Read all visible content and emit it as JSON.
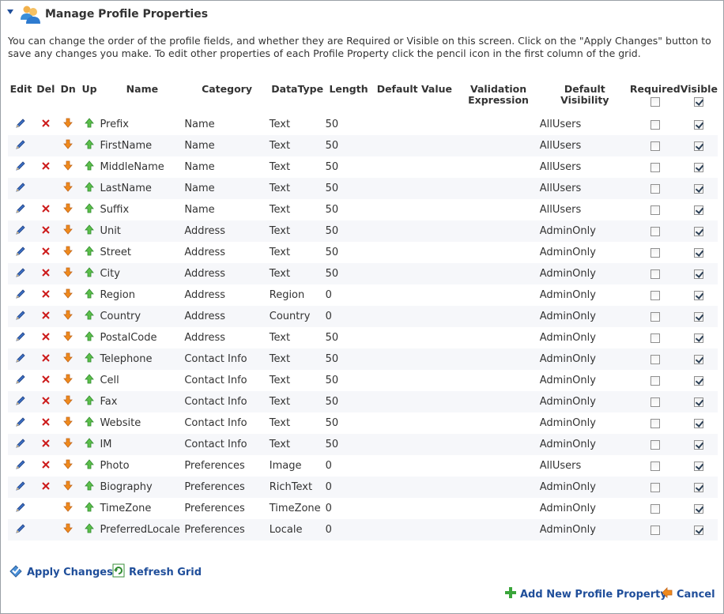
{
  "header": {
    "title": "Manage Profile Properties"
  },
  "intro": "You can change the order of the profile fields, and whether they are Required or Visible on this screen. Click on the \"Apply Changes\" button to save any changes you make. To edit other properties of each Profile Property click the pencil icon in the first column of the grid.",
  "columns": {
    "edit": "Edit",
    "del": "Del",
    "dn": "Dn",
    "up": "Up",
    "name": "Name",
    "category": "Category",
    "datatype": "DataType",
    "length": "Length",
    "default_value": "Default Value",
    "validation_1": "Validation",
    "validation_2": "Expression",
    "visibility_1": "Default",
    "visibility_2": "Visibility",
    "required": "Required",
    "visible": "Visible"
  },
  "rows": [
    {
      "name": "Prefix",
      "category": "Name",
      "datatype": "Text",
      "length": "50",
      "visibility": "AllUsers",
      "deletable": true,
      "required": false,
      "visible": true
    },
    {
      "name": "FirstName",
      "category": "Name",
      "datatype": "Text",
      "length": "50",
      "visibility": "AllUsers",
      "deletable": false,
      "required": false,
      "visible": true
    },
    {
      "name": "MiddleName",
      "category": "Name",
      "datatype": "Text",
      "length": "50",
      "visibility": "AllUsers",
      "deletable": true,
      "required": false,
      "visible": true
    },
    {
      "name": "LastName",
      "category": "Name",
      "datatype": "Text",
      "length": "50",
      "visibility": "AllUsers",
      "deletable": false,
      "required": false,
      "visible": true
    },
    {
      "name": "Suffix",
      "category": "Name",
      "datatype": "Text",
      "length": "50",
      "visibility": "AllUsers",
      "deletable": true,
      "required": false,
      "visible": true
    },
    {
      "name": "Unit",
      "category": "Address",
      "datatype": "Text",
      "length": "50",
      "visibility": "AdminOnly",
      "deletable": true,
      "required": false,
      "visible": true
    },
    {
      "name": "Street",
      "category": "Address",
      "datatype": "Text",
      "length": "50",
      "visibility": "AdminOnly",
      "deletable": true,
      "required": false,
      "visible": true
    },
    {
      "name": "City",
      "category": "Address",
      "datatype": "Text",
      "length": "50",
      "visibility": "AdminOnly",
      "deletable": true,
      "required": false,
      "visible": true
    },
    {
      "name": "Region",
      "category": "Address",
      "datatype": "Region",
      "length": "0",
      "visibility": "AdminOnly",
      "deletable": true,
      "required": false,
      "visible": true
    },
    {
      "name": "Country",
      "category": "Address",
      "datatype": "Country",
      "length": "0",
      "visibility": "AdminOnly",
      "deletable": true,
      "required": false,
      "visible": true
    },
    {
      "name": "PostalCode",
      "category": "Address",
      "datatype": "Text",
      "length": "50",
      "visibility": "AdminOnly",
      "deletable": true,
      "required": false,
      "visible": true
    },
    {
      "name": "Telephone",
      "category": "Contact Info",
      "datatype": "Text",
      "length": "50",
      "visibility": "AdminOnly",
      "deletable": true,
      "required": false,
      "visible": true
    },
    {
      "name": "Cell",
      "category": "Contact Info",
      "datatype": "Text",
      "length": "50",
      "visibility": "AdminOnly",
      "deletable": true,
      "required": false,
      "visible": true
    },
    {
      "name": "Fax",
      "category": "Contact Info",
      "datatype": "Text",
      "length": "50",
      "visibility": "AdminOnly",
      "deletable": true,
      "required": false,
      "visible": true
    },
    {
      "name": "Website",
      "category": "Contact Info",
      "datatype": "Text",
      "length": "50",
      "visibility": "AdminOnly",
      "deletable": true,
      "required": false,
      "visible": true
    },
    {
      "name": "IM",
      "category": "Contact Info",
      "datatype": "Text",
      "length": "50",
      "visibility": "AdminOnly",
      "deletable": true,
      "required": false,
      "visible": true
    },
    {
      "name": "Photo",
      "category": "Preferences",
      "datatype": "Image",
      "length": "0",
      "visibility": "AllUsers",
      "deletable": true,
      "required": false,
      "visible": true
    },
    {
      "name": "Biography",
      "category": "Preferences",
      "datatype": "RichText",
      "length": "0",
      "visibility": "AdminOnly",
      "deletable": true,
      "required": false,
      "visible": true
    },
    {
      "name": "TimeZone",
      "category": "Preferences",
      "datatype": "TimeZone",
      "length": "0",
      "visibility": "AdminOnly",
      "deletable": false,
      "required": false,
      "visible": true
    },
    {
      "name": "PreferredLocale",
      "category": "Preferences",
      "datatype": "Locale",
      "length": "0",
      "visibility": "AdminOnly",
      "deletable": false,
      "required": false,
      "visible": true
    }
  ],
  "actions": {
    "apply_changes": "Apply Changes",
    "refresh_grid": "Refresh Grid",
    "add_new": "Add New Profile Property",
    "cancel": "Cancel"
  },
  "icons": {
    "edit": "pencil-icon",
    "delete": "red-x-icon",
    "move_down": "orange-down-arrow-icon",
    "move_up": "green-up-arrow-icon",
    "header": "users-icon"
  },
  "colors": {
    "link": "#1f4e9a",
    "delete": "#cc1a1a",
    "down": "#f08a1c",
    "up": "#3aa53a"
  }
}
